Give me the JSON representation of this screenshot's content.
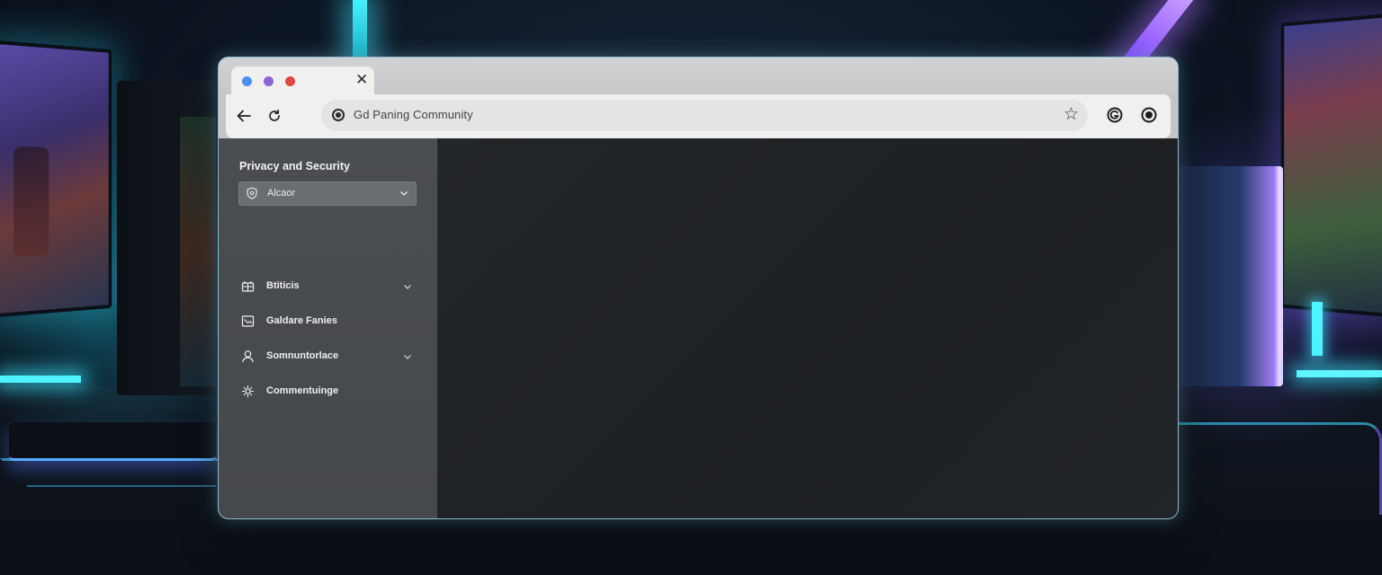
{
  "browser": {
    "tab": {
      "dots": [
        "#4a8ff0",
        "#8a63d4",
        "#e04545"
      ],
      "close_icon": "close-icon"
    },
    "toolbar": {
      "back_icon": "arrow-left-icon",
      "reload_icon": "reload-icon",
      "url": "Gd Paning Community",
      "bookmark_icon": "star-icon",
      "extensions": [
        "extension-g-icon",
        "extension-circle-icon"
      ]
    }
  },
  "sidebar": {
    "title": "Privacy and Security",
    "dropdown": {
      "label": "Alcaor",
      "icon": "shield-settings-icon"
    },
    "items": [
      {
        "label": "Btiticis",
        "icon": "grid-icon",
        "expandable": true
      },
      {
        "label": "Galdare Fanies",
        "icon": "image-icon",
        "expandable": false
      },
      {
        "label": "Somnuntorlace",
        "icon": "user-icon",
        "expandable": true
      },
      {
        "label": "Commentuinge",
        "icon": "sparkle-icon",
        "expandable": false
      }
    ]
  },
  "colors": {
    "accent_cyan": "#45f3ff",
    "accent_purple": "#8a63d4",
    "sidebar_bg": "#4a4d52",
    "content_bg": "#1f2226"
  }
}
